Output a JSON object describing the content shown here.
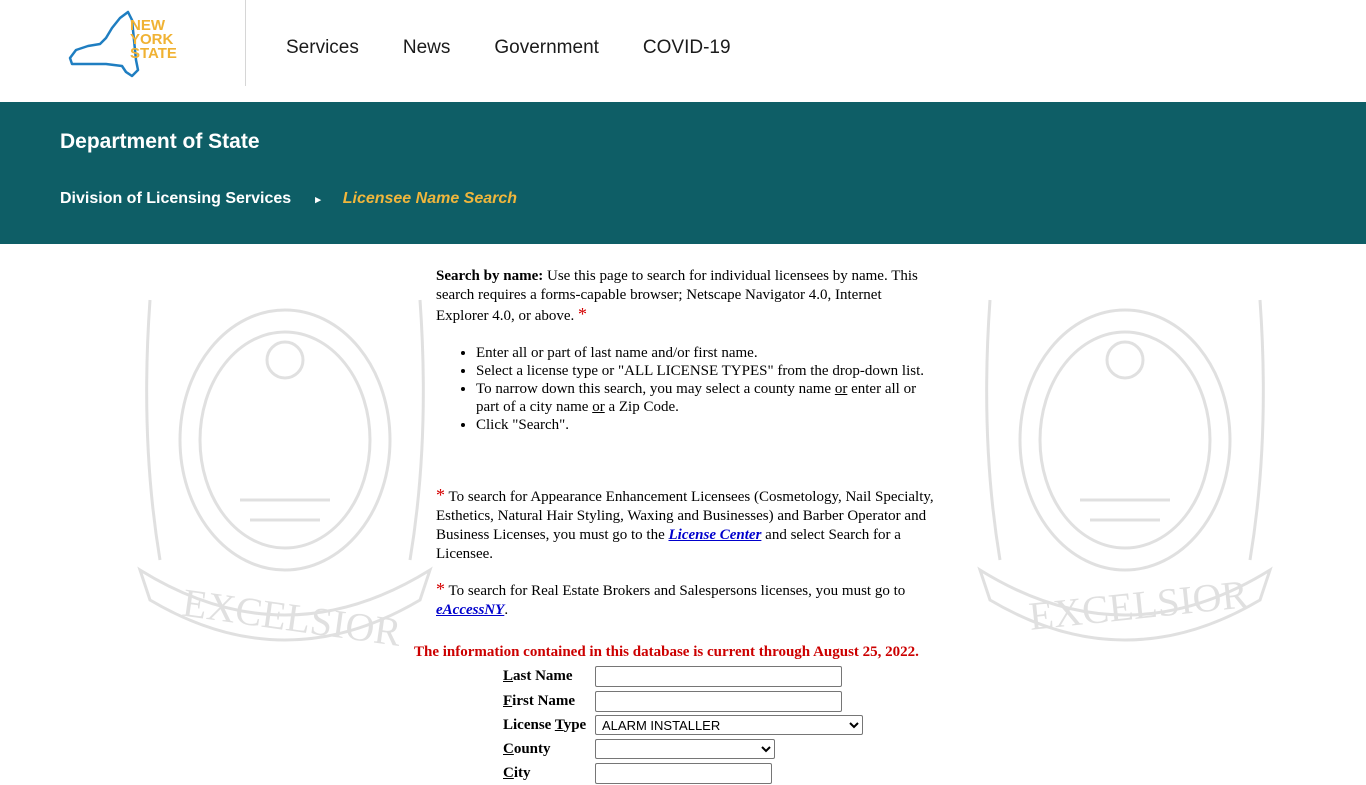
{
  "header": {
    "logo": {
      "alt": "New York State",
      "line1": "NEW",
      "line2": "YORK",
      "line3": "STATE"
    },
    "nav": [
      {
        "label": "Services"
      },
      {
        "label": "News"
      },
      {
        "label": "Government"
      },
      {
        "label": "COVID-19"
      }
    ]
  },
  "banner": {
    "title": "Department of State",
    "breadcrumb": {
      "parent": "Division of Licensing Services",
      "separator": "▸",
      "current": "Licensee Name Search"
    }
  },
  "intro": {
    "lead_bold": "Search by name:",
    "lead_text": " Use this page to search for individual licensees by name. This search requires a forms-capable browser; Netscape Navigator 4.0, Internet Explorer 4.0, or above. ",
    "star": "*"
  },
  "instructions": [
    {
      "text": "Enter all or part of last name and/or first name."
    },
    {
      "text": "Select a license type or \"ALL LICENSE TYPES\" from the drop-down list."
    },
    {
      "pre": "To narrow down this search, you may select a county name ",
      "or1": "or",
      "mid": " enter all or part of a city name ",
      "or2": "or",
      "post": " a Zip Code."
    },
    {
      "text": "Click \"Search\"."
    }
  ],
  "notes": {
    "appearance": {
      "star": "*",
      "text": " To search for Appearance Enhancement Licensees (Cosmetology, Nail Specialty, Esthetics, Natural Hair Styling, Waxing and Businesses) and Barber Operator and Business Licenses, you must go to the ",
      "link": "License Center",
      "after": " and select Search for a Licensee."
    },
    "real_estate": {
      "star": "*",
      "text": " To search for Real Estate Brokers and Salespersons licenses, you must go to ",
      "link": "eAccessNY",
      "after": "."
    }
  },
  "db_notice": "The information contained in this database is current through August 25, 2022.",
  "form": {
    "last_name": {
      "accel": "L",
      "rest": "ast Name",
      "value": ""
    },
    "first_name": {
      "accel": "F",
      "rest": "irst Name",
      "value": ""
    },
    "license_type": {
      "pre": "License ",
      "accel": "T",
      "rest": "ype",
      "selected": "ALARM INSTALLER"
    },
    "county": {
      "accel": "C",
      "rest": "ounty",
      "selected": ""
    },
    "city": {
      "accel": "C",
      "rest": "ity",
      "value": ""
    }
  },
  "colors": {
    "banner": "#0e5e66",
    "breadcrumb_current": "#f0b63c",
    "notice_red": "#cc0000",
    "logo_blue": "#1f7ec1",
    "logo_gold": "#f0b233"
  }
}
